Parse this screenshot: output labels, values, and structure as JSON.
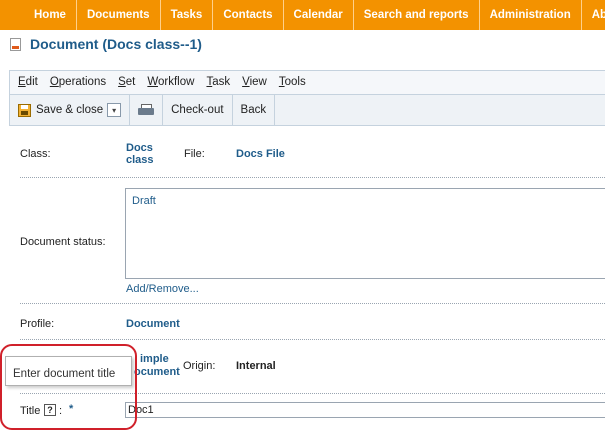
{
  "topnav": {
    "items": [
      "Home",
      "Documents",
      "Tasks",
      "Contacts",
      "Calendar",
      "Search and reports",
      "Administration",
      "About"
    ],
    "color": "#f39200"
  },
  "header": {
    "title": "Document (Docs class--1)"
  },
  "menubar": {
    "items": [
      {
        "key": "E",
        "rest": "dit"
      },
      {
        "key": "O",
        "rest": "perations"
      },
      {
        "key": "S",
        "rest": "et"
      },
      {
        "key": "W",
        "rest": "orkflow"
      },
      {
        "key": "T",
        "rest": "ask"
      },
      {
        "key": "V",
        "rest": "iew"
      },
      {
        "key": "T",
        "rest": "ools"
      }
    ]
  },
  "toolbar": {
    "save_close": "Save & close",
    "dropdown_glyph": "▾",
    "checkout": "Check-out",
    "back": "Back"
  },
  "form": {
    "class_label": "Class:",
    "class_value_line1": "Docs",
    "class_value_line2": "class",
    "file_label": "File:",
    "file_value": "Docs File",
    "status_label": "Document status:",
    "status_items": [
      "Draft"
    ],
    "add_remove": "Add/Remove...",
    "profile_label": "Profile:",
    "profile_value": "Document",
    "type_value_line1": "imple",
    "type_value_line2": "ocument",
    "origin_label": "Origin:",
    "origin_value": "Internal",
    "title_label": "Title",
    "help_glyph": "?",
    "title_colon": ":",
    "required_mark": "*",
    "title_value": "Doc1"
  },
  "tooltip": {
    "text": "Enter document title"
  },
  "colors": {
    "accent": "#f39200",
    "link": "#1f5c8a",
    "highlight": "#d0202a"
  }
}
